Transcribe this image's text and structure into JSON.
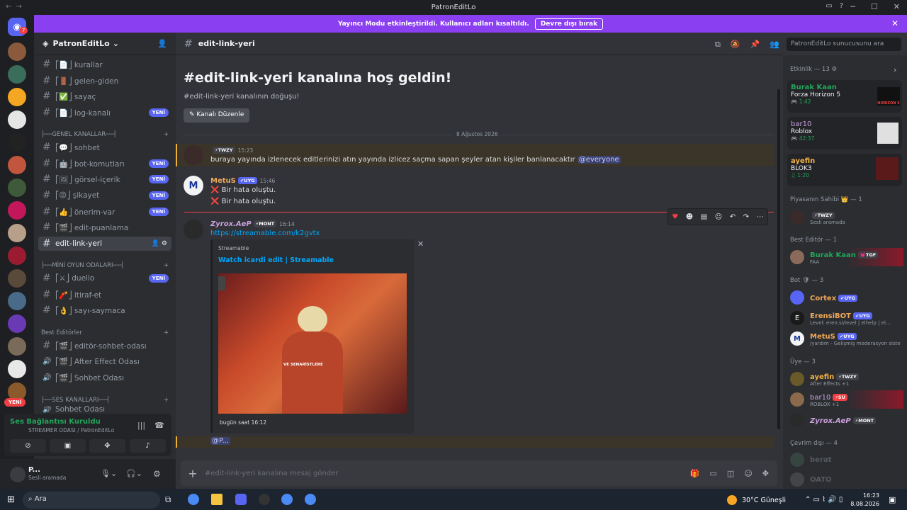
{
  "window": {
    "title": "PatronEditLo"
  },
  "banner": {
    "text": "Yayıncı Modu etkinleştirildi. Kullanıcı adları kısaltıldı.",
    "button": "Devre dışı bırak"
  },
  "server": {
    "name": "PatronEditLo",
    "badge": "7",
    "new_pill": "YENİ"
  },
  "channels": [
    {
      "label": "⎡📄⎦ kurallar",
      "new": ""
    },
    {
      "label": "⎡🚪⎦ gelen-giden",
      "new": ""
    },
    {
      "label": "⎡✅⎦ sayaç",
      "new": ""
    },
    {
      "label": "⎡📄⎦ log-kanalı",
      "new": "YENİ"
    },
    {
      "label": "⎡💬⎦ sohbet",
      "new": ""
    },
    {
      "label": "⎡🤖⎦ bot-komutları",
      "new": "YENİ"
    },
    {
      "label": "⎡🖼⎦ görsel-içerik",
      "new": "YENİ"
    },
    {
      "label": "⎡😡⎦ şikayet",
      "new": "YENİ"
    },
    {
      "label": "⎡👍⎦ önerim-var",
      "new": "YENİ"
    },
    {
      "label": "⎡🎬⎦ edit-puanlama",
      "new": ""
    },
    {
      "label": "edit-link-yeri",
      "new": ""
    },
    {
      "label": "⎡⚔⎦ duello",
      "new": "YENİ"
    },
    {
      "label": "⎡🧨⎦ itiraf-et",
      "new": ""
    },
    {
      "label": "⎡👌⎦ sayı-saymaca",
      "new": ""
    },
    {
      "label": "⎡🎬⎦ editör-sohbet-odası",
      "new": ""
    },
    {
      "label": "⎡🎬⎦ After Effect Odası",
      "new": ""
    },
    {
      "label": "⎡🎬⎦ Sohbet Odası",
      "new": ""
    },
    {
      "label": "Sohbet Odası",
      "new": ""
    }
  ],
  "categories": [
    "├──GENEL KANALLAR──┤",
    "├──MİNİ OYUN ODALARI──┤",
    "Best Editörler",
    "├──SES KANALLARI──┤"
  ],
  "voice": {
    "status": "Ses Bağlantısı Kuruldu",
    "channel": "STREAMER ODASI / PatronEditLo"
  },
  "user": {
    "name": "P...",
    "status": "Sesli aramada"
  },
  "channel_header": {
    "name": "edit-link-yeri",
    "search_placeholder": "PatronEditLo sunucusunu ara"
  },
  "welcome": {
    "title": "#edit-link-yeri kanalına hoş geldin!",
    "sub": "#edit-link-yeri kanalının doğuşu!",
    "edit_button": "Kanalı Düzenle"
  },
  "date_divider": "8 Ağustos 2026",
  "messages": [
    {
      "name": "",
      "tag": "⚡TWZY",
      "time": "15:23",
      "lines": [
        "buraya yayında izlenecek editlerinizi atın yayında izlicez saçma sapan şeyler atan kişiler banlanacaktır"
      ],
      "mention": "@everyone"
    },
    {
      "name": "MetuS",
      "tag": "✔UYG",
      "time": "15:46",
      "lines": [
        "❌ Bir hata oluştu.",
        "❌ Bir hata oluştu."
      ]
    },
    {
      "name": "Zyrox.AeP",
      "tag": "⚡MONT",
      "time": "16:14",
      "link": "https://streamable.com/k2gvtx"
    }
  ],
  "embed": {
    "provider": "Streamable",
    "title": "Watch icardi edit | Streamable",
    "footer": "bugün saat 16:12",
    "overlay": "VE SENARİSTLERE"
  },
  "draft_mention": "@P...",
  "composer": {
    "placeholder": "#edit-link-yeri kanalına mesaj gönder"
  },
  "members": {
    "activity_header": "Etkinlik — 13",
    "activities": [
      {
        "name": "Burak Kaan",
        "game": "Forza Horizon 5",
        "time": "1:42",
        "logo": "HORIZON 5"
      },
      {
        "name": "bar10",
        "game": "Roblox",
        "time": "42:37",
        "logo": ""
      },
      {
        "name": "ayefin",
        "game": "BLOK3",
        "time": "1:20",
        "logo": ""
      }
    ],
    "groups": [
      {
        "title": "Piyasanın Sahibi 👑 — 1",
        "list": [
          {
            "name": "",
            "tag": "⚡TWZY",
            "sub": "Sesli aramada",
            "color": "#dbdee1"
          }
        ]
      },
      {
        "title": "Best Editör — 1",
        "list": [
          {
            "name": "Burak Kaan",
            "tag": "💗TGF",
            "sub": "FAA",
            "color": "#23a55a"
          }
        ]
      },
      {
        "title": "Bot 🛡 — 3",
        "list": [
          {
            "name": "Cortex",
            "tag": "✔UYG",
            "sub": "",
            "color": "#f0a85a"
          },
          {
            "name": "ErensiBOT",
            "tag": "✔UYG",
            "sub": "Level: eren.si/level | elhelp | el...",
            "color": "#f0a85a"
          },
          {
            "name": "MetuS",
            "tag": "✔UYG",
            "sub": "/yardım - Gelişmiş moderasyon siste",
            "color": "#f0a85a"
          }
        ]
      },
      {
        "title": "Üye — 3",
        "list": [
          {
            "name": "ayefin",
            "tag": "⚡TWZY",
            "sub": "After Effects +1",
            "color": "#f5b342"
          },
          {
            "name": "bar10",
            "tag": "⚡SU",
            "sub": "ROBLOX +1",
            "color": "#c9a0dc"
          },
          {
            "name": "Zyrox.AeP",
            "tag": "⚡MONT",
            "sub": "",
            "color": "#c9a0dc"
          }
        ]
      },
      {
        "title": "Çevrim dışı — 4",
        "list": [
          {
            "name": "berat",
            "tag": "",
            "sub": "",
            "color": "#5c5f66"
          },
          {
            "name": "OATO",
            "tag": "",
            "sub": "",
            "color": "#5c5f66"
          }
        ]
      }
    ]
  },
  "taskbar": {
    "search": "Ara",
    "weather": "30°C Güneşli",
    "time": "16:23",
    "date": "8.08.2026"
  }
}
